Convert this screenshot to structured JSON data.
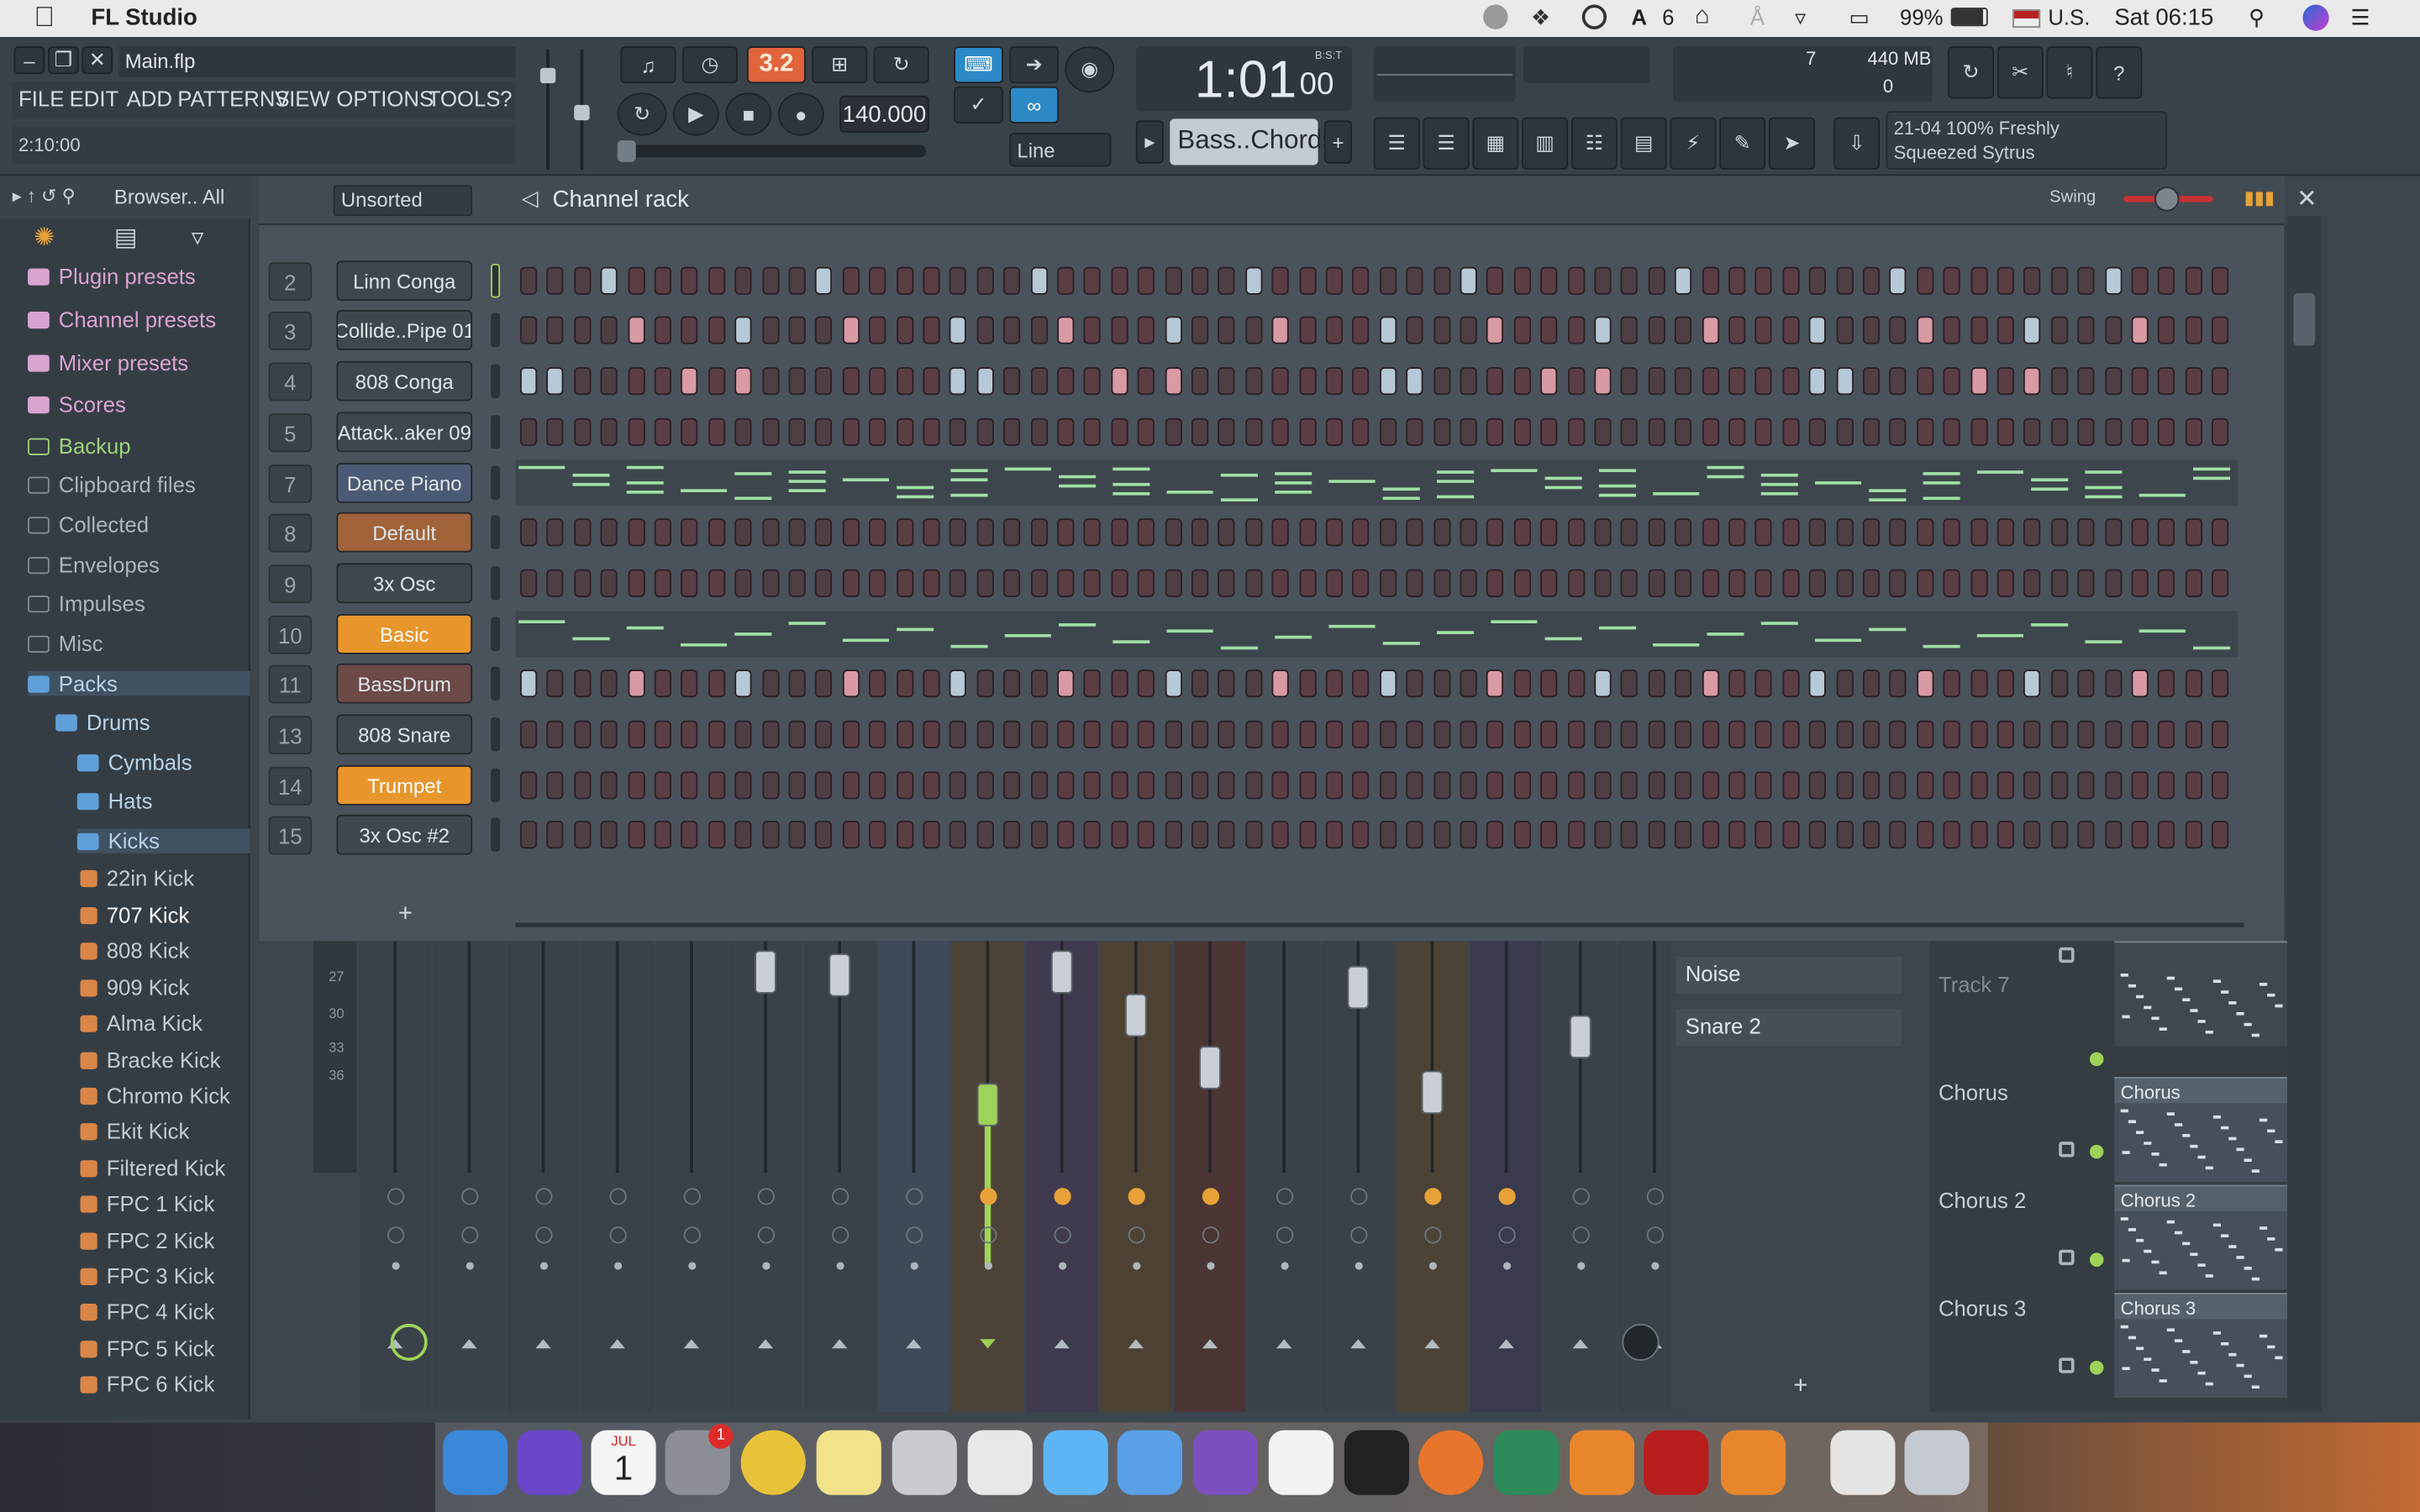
{
  "menubar": {
    "app_name": "FL Studio",
    "badge_count": "6",
    "battery": "99%",
    "input_source": "U.S.",
    "clock": "Sat 06:15"
  },
  "toolbar": {
    "filename": "Main.flp",
    "menu": [
      "FILE",
      "EDIT",
      "ADD",
      "PATTERNS",
      "VIEW",
      "OPTIONS",
      "TOOLS",
      "?"
    ],
    "hint": "2:10:00",
    "pattern_mode": "3.2",
    "tempo": "140.000",
    "song_time": "1:01",
    "song_time_small": "00",
    "time_label": "B:S:T",
    "snap": "Line",
    "pattern_name": "Bass..Chords",
    "cpu_value": "7",
    "memory": "440 MB",
    "polyphony": "0",
    "news_line1": "21-04  100% Freshly",
    "news_line2": "Squeezed Sytrus"
  },
  "browser": {
    "header": "Browser.. All",
    "items": [
      {
        "label": "Plugin presets",
        "kind": "special"
      },
      {
        "label": "Channel presets",
        "kind": "special"
      },
      {
        "label": "Mixer presets",
        "kind": "special"
      },
      {
        "label": "Scores",
        "kind": "special"
      },
      {
        "label": "Backup",
        "kind": "backup"
      },
      {
        "label": "Clipboard files",
        "kind": "folder"
      },
      {
        "label": "Collected",
        "kind": "folder"
      },
      {
        "label": "Envelopes",
        "kind": "folder"
      },
      {
        "label": "Impulses",
        "kind": "folder"
      },
      {
        "label": "Misc",
        "kind": "folder"
      },
      {
        "label": "Packs",
        "kind": "pack"
      },
      {
        "label": "Drums",
        "kind": "pack"
      },
      {
        "label": "Cymbals",
        "kind": "pack"
      },
      {
        "label": "Hats",
        "kind": "pack"
      },
      {
        "label": "Kicks",
        "kind": "pack"
      },
      {
        "label": "22in Kick",
        "kind": "sample"
      },
      {
        "label": "707 Kick",
        "kind": "sample"
      },
      {
        "label": "808 Kick",
        "kind": "sample"
      },
      {
        "label": "909 Kick",
        "kind": "sample"
      },
      {
        "label": "Alma Kick",
        "kind": "sample"
      },
      {
        "label": "Bracke Kick",
        "kind": "sample"
      },
      {
        "label": "Chromo Kick",
        "kind": "sample"
      },
      {
        "label": "Ekit Kick",
        "kind": "sample"
      },
      {
        "label": "Filtered Kick",
        "kind": "sample"
      },
      {
        "label": "FPC 1 Kick",
        "kind": "sample"
      },
      {
        "label": "FPC 2 Kick",
        "kind": "sample"
      },
      {
        "label": "FPC 3 Kick",
        "kind": "sample"
      },
      {
        "label": "FPC 4 Kick",
        "kind": "sample"
      },
      {
        "label": "FPC 5 Kick",
        "kind": "sample"
      },
      {
        "label": "FPC 6 Kick",
        "kind": "sample"
      }
    ]
  },
  "channel_rack": {
    "filter": "Unsorted",
    "title": "Channel rack",
    "swing_label": "Swing",
    "add_label": "+",
    "channels": [
      {
        "num": "2",
        "name": "Linn Conga",
        "color": "#3f474e",
        "type": "steps",
        "pattern": "x2"
      },
      {
        "num": "3",
        "name": "Collide..Pipe 01",
        "color": "#3f474e",
        "type": "steps",
        "pattern": "x3"
      },
      {
        "num": "4",
        "name": "808 Conga",
        "color": "#3f474e",
        "type": "steps",
        "pattern": "x4"
      },
      {
        "num": "5",
        "name": "Attack..aker 09",
        "color": "#3f474e",
        "type": "steps",
        "pattern": "none"
      },
      {
        "num": "7",
        "name": "Dance Piano",
        "color": "#4b5a74",
        "type": "roll",
        "pattern": "piano"
      },
      {
        "num": "8",
        "name": "Default",
        "color": "#a0633a",
        "type": "steps",
        "pattern": "none"
      },
      {
        "num": "9",
        "name": "3x Osc",
        "color": "#3f474e",
        "type": "steps",
        "pattern": "none"
      },
      {
        "num": "10",
        "name": "Basic",
        "color": "#e8952c",
        "type": "roll",
        "pattern": "bass"
      },
      {
        "num": "11",
        "name": "BassDrum",
        "color": "#6b4a48",
        "type": "steps",
        "pattern": "x11"
      },
      {
        "num": "13",
        "name": "808 Snare",
        "color": "#3f474e",
        "type": "steps",
        "pattern": "none"
      },
      {
        "num": "14",
        "name": "Trumpet",
        "color": "#e8952c",
        "type": "steps",
        "pattern": "none"
      },
      {
        "num": "15",
        "name": "3x Osc #2",
        "color": "#3f474e",
        "type": "steps",
        "pattern": "none"
      }
    ]
  },
  "mixer": {
    "scale": [
      "27",
      "30",
      "33",
      "36"
    ]
  },
  "playlist": {
    "patterns": [
      "Noise",
      "Snare 2"
    ],
    "tracks": [
      "Track 7",
      "Chorus",
      "Chorus 2",
      "Chorus 3"
    ],
    "clips": [
      "",
      "Chorus",
      "Chorus 2",
      "Chorus 3"
    ],
    "add_label": "+"
  },
  "dock": {
    "calendar_month": "JUL",
    "calendar_day": "1",
    "notification": "1"
  }
}
